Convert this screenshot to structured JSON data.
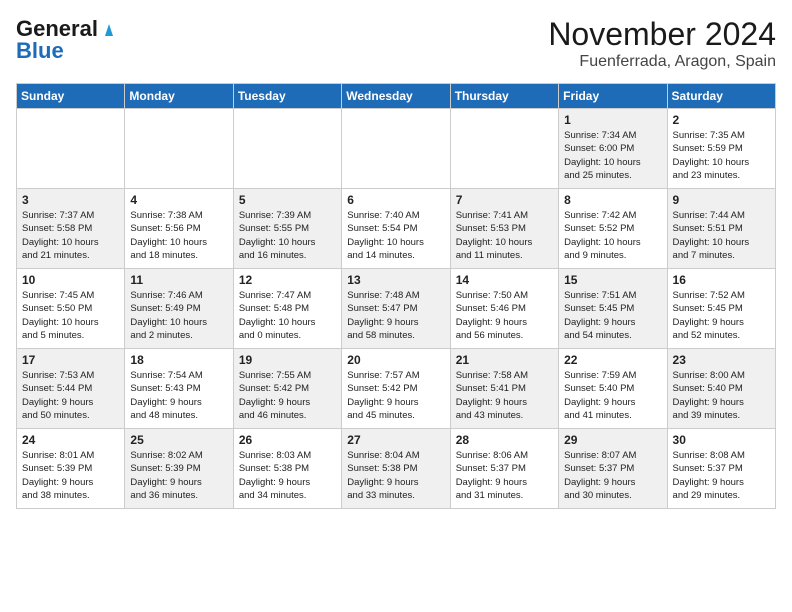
{
  "header": {
    "logo_general": "General",
    "logo_blue": "Blue",
    "month_title": "November 2024",
    "location": "Fuenferrada, Aragon, Spain"
  },
  "days_of_week": [
    "Sunday",
    "Monday",
    "Tuesday",
    "Wednesday",
    "Thursday",
    "Friday",
    "Saturday"
  ],
  "weeks": [
    [
      {
        "day": "",
        "info": "",
        "empty": true
      },
      {
        "day": "",
        "info": "",
        "empty": true
      },
      {
        "day": "",
        "info": "",
        "empty": true
      },
      {
        "day": "",
        "info": "",
        "empty": true
      },
      {
        "day": "",
        "info": "",
        "empty": true
      },
      {
        "day": "1",
        "info": "Sunrise: 7:34 AM\nSunset: 6:00 PM\nDaylight: 10 hours\nand 25 minutes.",
        "shaded": true
      },
      {
        "day": "2",
        "info": "Sunrise: 7:35 AM\nSunset: 5:59 PM\nDaylight: 10 hours\nand 23 minutes.",
        "shaded": false
      }
    ],
    [
      {
        "day": "3",
        "info": "Sunrise: 7:37 AM\nSunset: 5:58 PM\nDaylight: 10 hours\nand 21 minutes.",
        "shaded": true
      },
      {
        "day": "4",
        "info": "Sunrise: 7:38 AM\nSunset: 5:56 PM\nDaylight: 10 hours\nand 18 minutes.",
        "shaded": false
      },
      {
        "day": "5",
        "info": "Sunrise: 7:39 AM\nSunset: 5:55 PM\nDaylight: 10 hours\nand 16 minutes.",
        "shaded": true
      },
      {
        "day": "6",
        "info": "Sunrise: 7:40 AM\nSunset: 5:54 PM\nDaylight: 10 hours\nand 14 minutes.",
        "shaded": false
      },
      {
        "day": "7",
        "info": "Sunrise: 7:41 AM\nSunset: 5:53 PM\nDaylight: 10 hours\nand 11 minutes.",
        "shaded": true
      },
      {
        "day": "8",
        "info": "Sunrise: 7:42 AM\nSunset: 5:52 PM\nDaylight: 10 hours\nand 9 minutes.",
        "shaded": false
      },
      {
        "day": "9",
        "info": "Sunrise: 7:44 AM\nSunset: 5:51 PM\nDaylight: 10 hours\nand 7 minutes.",
        "shaded": true
      }
    ],
    [
      {
        "day": "10",
        "info": "Sunrise: 7:45 AM\nSunset: 5:50 PM\nDaylight: 10 hours\nand 5 minutes.",
        "shaded": false
      },
      {
        "day": "11",
        "info": "Sunrise: 7:46 AM\nSunset: 5:49 PM\nDaylight: 10 hours\nand 2 minutes.",
        "shaded": true
      },
      {
        "day": "12",
        "info": "Sunrise: 7:47 AM\nSunset: 5:48 PM\nDaylight: 10 hours\nand 0 minutes.",
        "shaded": false
      },
      {
        "day": "13",
        "info": "Sunrise: 7:48 AM\nSunset: 5:47 PM\nDaylight: 9 hours\nand 58 minutes.",
        "shaded": true
      },
      {
        "day": "14",
        "info": "Sunrise: 7:50 AM\nSunset: 5:46 PM\nDaylight: 9 hours\nand 56 minutes.",
        "shaded": false
      },
      {
        "day": "15",
        "info": "Sunrise: 7:51 AM\nSunset: 5:45 PM\nDaylight: 9 hours\nand 54 minutes.",
        "shaded": true
      },
      {
        "day": "16",
        "info": "Sunrise: 7:52 AM\nSunset: 5:45 PM\nDaylight: 9 hours\nand 52 minutes.",
        "shaded": false
      }
    ],
    [
      {
        "day": "17",
        "info": "Sunrise: 7:53 AM\nSunset: 5:44 PM\nDaylight: 9 hours\nand 50 minutes.",
        "shaded": true
      },
      {
        "day": "18",
        "info": "Sunrise: 7:54 AM\nSunset: 5:43 PM\nDaylight: 9 hours\nand 48 minutes.",
        "shaded": false
      },
      {
        "day": "19",
        "info": "Sunrise: 7:55 AM\nSunset: 5:42 PM\nDaylight: 9 hours\nand 46 minutes.",
        "shaded": true
      },
      {
        "day": "20",
        "info": "Sunrise: 7:57 AM\nSunset: 5:42 PM\nDaylight: 9 hours\nand 45 minutes.",
        "shaded": false
      },
      {
        "day": "21",
        "info": "Sunrise: 7:58 AM\nSunset: 5:41 PM\nDaylight: 9 hours\nand 43 minutes.",
        "shaded": true
      },
      {
        "day": "22",
        "info": "Sunrise: 7:59 AM\nSunset: 5:40 PM\nDaylight: 9 hours\nand 41 minutes.",
        "shaded": false
      },
      {
        "day": "23",
        "info": "Sunrise: 8:00 AM\nSunset: 5:40 PM\nDaylight: 9 hours\nand 39 minutes.",
        "shaded": true
      }
    ],
    [
      {
        "day": "24",
        "info": "Sunrise: 8:01 AM\nSunset: 5:39 PM\nDaylight: 9 hours\nand 38 minutes.",
        "shaded": false
      },
      {
        "day": "25",
        "info": "Sunrise: 8:02 AM\nSunset: 5:39 PM\nDaylight: 9 hours\nand 36 minutes.",
        "shaded": true
      },
      {
        "day": "26",
        "info": "Sunrise: 8:03 AM\nSunset: 5:38 PM\nDaylight: 9 hours\nand 34 minutes.",
        "shaded": false
      },
      {
        "day": "27",
        "info": "Sunrise: 8:04 AM\nSunset: 5:38 PM\nDaylight: 9 hours\nand 33 minutes.",
        "shaded": true
      },
      {
        "day": "28",
        "info": "Sunrise: 8:06 AM\nSunset: 5:37 PM\nDaylight: 9 hours\nand 31 minutes.",
        "shaded": false
      },
      {
        "day": "29",
        "info": "Sunrise: 8:07 AM\nSunset: 5:37 PM\nDaylight: 9 hours\nand 30 minutes.",
        "shaded": true
      },
      {
        "day": "30",
        "info": "Sunrise: 8:08 AM\nSunset: 5:37 PM\nDaylight: 9 hours\nand 29 minutes.",
        "shaded": false
      }
    ]
  ]
}
